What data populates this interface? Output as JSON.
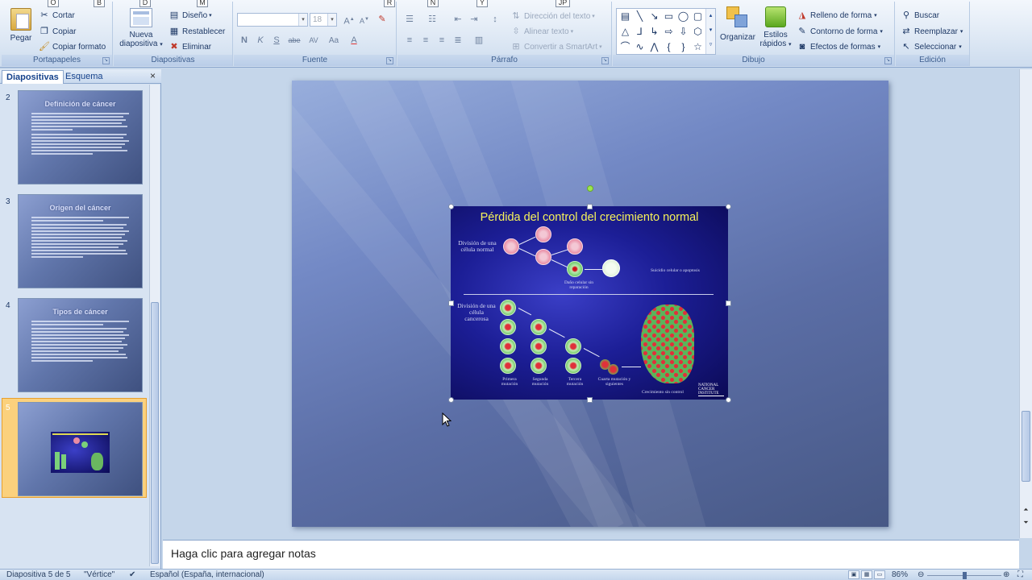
{
  "ribbon": {
    "keytips": [
      "O",
      "B",
      "D",
      "M",
      "R",
      "N",
      "Y",
      "JP"
    ],
    "portapapeles": {
      "label": "Portapapeles",
      "paste": "Pegar",
      "cut": "Cortar",
      "copy": "Copiar",
      "format_painter": "Copiar formato"
    },
    "diapositivas": {
      "label": "Diapositivas",
      "new_slide_line1": "Nueva",
      "new_slide_line2": "diapositiva",
      "layout": "Diseño",
      "reset": "Restablecer",
      "delete": "Eliminar"
    },
    "fuente": {
      "label": "Fuente",
      "font_name": "",
      "font_size": "18",
      "bold": "N",
      "italic": "K",
      "underline": "S",
      "strike": "abe",
      "spacing": "AV",
      "case": "Aa",
      "color": "A"
    },
    "parrafo": {
      "label": "Párrafo",
      "text_direction": "Dirección del texto",
      "align_text": "Alinear texto",
      "smartart": "Convertir a SmartArt"
    },
    "dibujo": {
      "label": "Dibujo",
      "arrange": "Organizar",
      "quick_styles_line1": "Estilos",
      "quick_styles_line2": "rápidos",
      "shape_fill": "Relleno de forma",
      "shape_outline": "Contorno de forma",
      "shape_effects": "Efectos de formas"
    },
    "edicion": {
      "label": "Edición",
      "find": "Buscar",
      "replace": "Reemplazar",
      "select": "Seleccionar"
    }
  },
  "left_pane": {
    "tabs": [
      "Diapositivas",
      "Esquema"
    ],
    "close": "×",
    "slides": [
      {
        "num": "2",
        "title": "Definición de cáncer"
      },
      {
        "num": "3",
        "title": "Origen del cáncer"
      },
      {
        "num": "4",
        "title": "Tipos de cáncer"
      },
      {
        "num": "5",
        "title": ""
      }
    ]
  },
  "slide_image": {
    "title": "Pérdida del control del crecimiento normal",
    "normal_label": "División de una célula normal",
    "damage_label": "Daño celular sin reparación",
    "apoptosis_label": "Suicidio celular o apoptosis",
    "cancer_label": "División de una célula cancerosa",
    "mutation1": "Primera mutación",
    "mutation2": "Segunda mutación",
    "mutation3": "Tercera mutación",
    "mutation4": "Cuarta mutación y siguientes",
    "uncontrolled": "Crecimiento sin control",
    "institute": "NATIONAL CANCER INSTITUTE"
  },
  "notes": {
    "placeholder": "Haga clic para agregar notas"
  },
  "status": {
    "slide_counter": "Diapositiva 5 de 5",
    "theme": "\"Vértice\"",
    "language": "Español (España, internacional)",
    "zoom": "86%"
  },
  "colors": {
    "ribbon_bg": "#dfe9f5",
    "selected_thumb": "#fbd17d",
    "slide_title_yellow": "#f6f25a"
  }
}
